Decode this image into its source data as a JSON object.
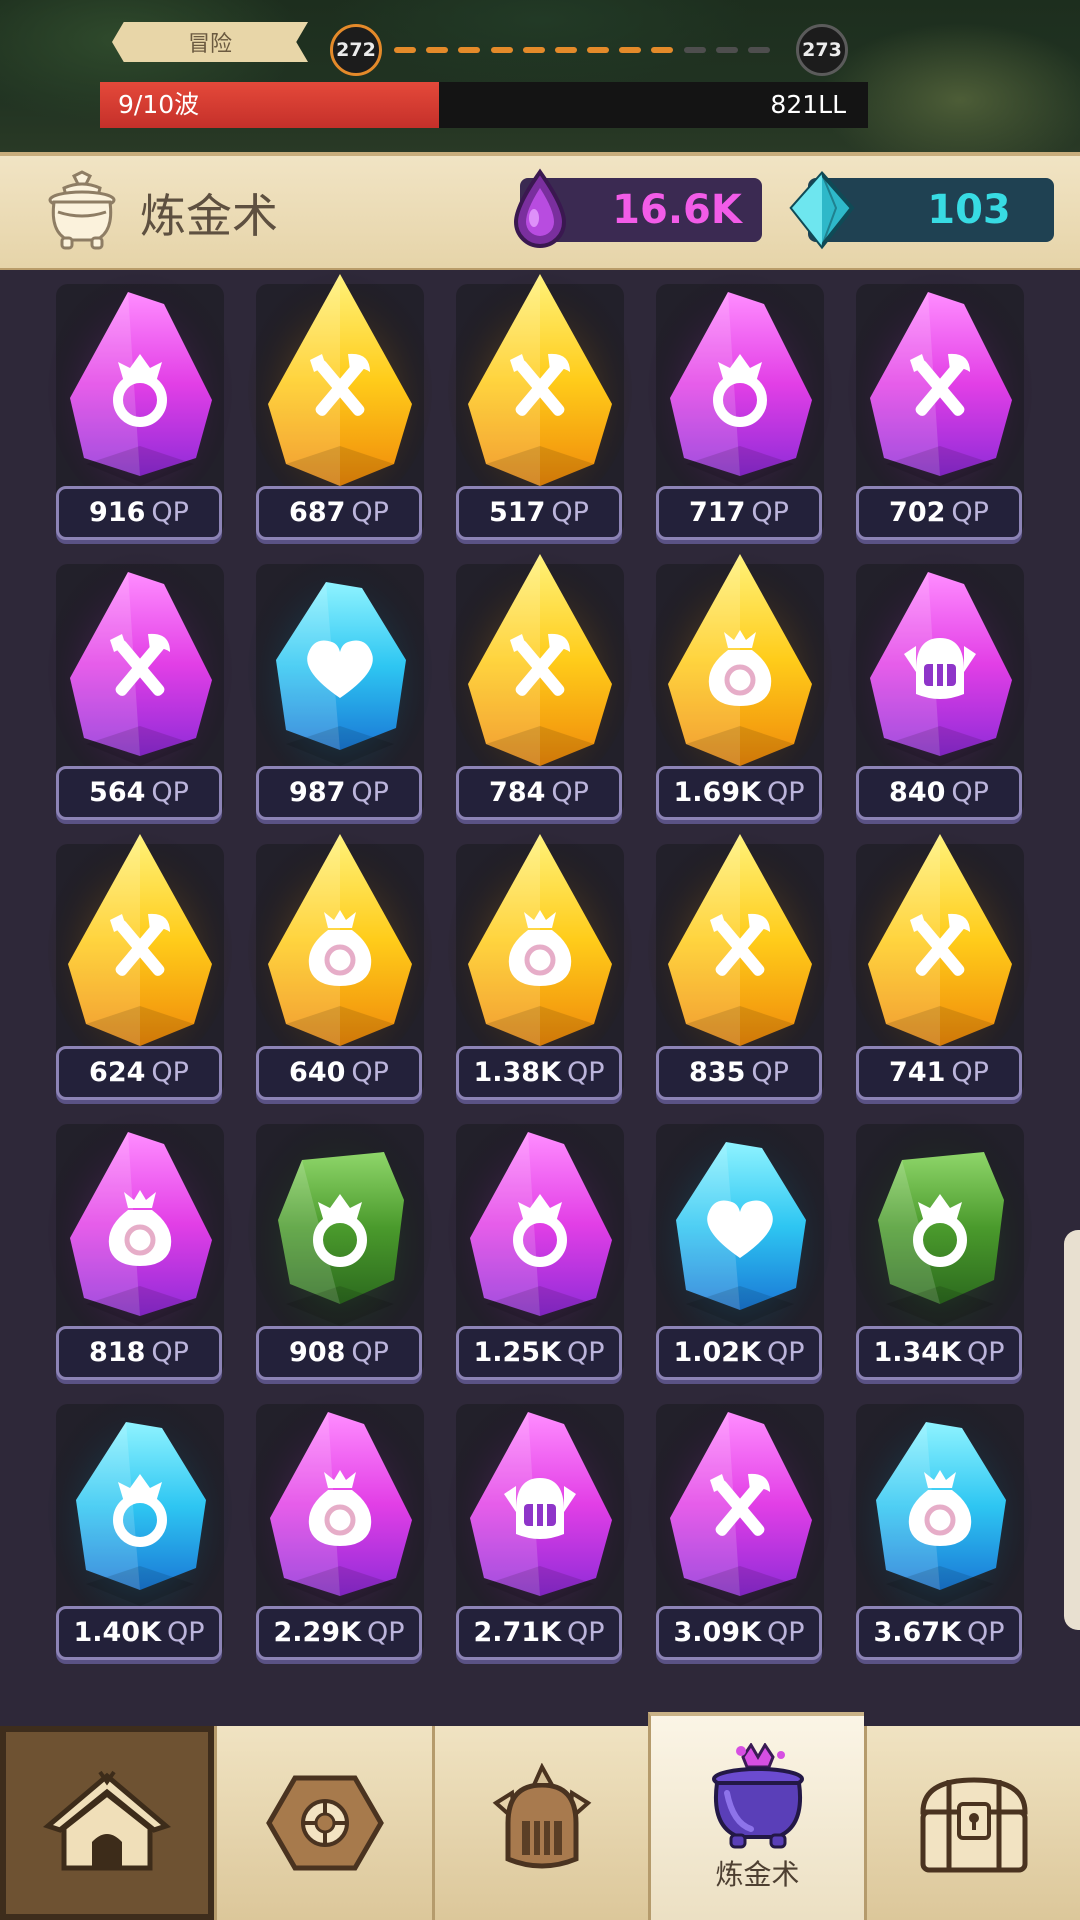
{
  "top_bar": {
    "mode_label": "冒险",
    "current_stage": "272",
    "next_stage": "273",
    "wave_text": "9/10波",
    "wave_progress": 0.9,
    "power_text": "821LL"
  },
  "header": {
    "title": "炼金术",
    "elixir_amount": "16.6K",
    "gem_amount": "103"
  },
  "crystals": [
    {
      "value": "916",
      "unit": "QP",
      "color": "purple",
      "icon": "ring-flame-icon"
    },
    {
      "value": "687",
      "unit": "QP",
      "color": "gold",
      "icon": "crossed-tools-icon"
    },
    {
      "value": "517",
      "unit": "QP",
      "color": "gold",
      "icon": "crossed-tools-icon"
    },
    {
      "value": "717",
      "unit": "QP",
      "color": "purple",
      "icon": "ring-flame-icon"
    },
    {
      "value": "702",
      "unit": "QP",
      "color": "purple",
      "icon": "crossed-tools-icon"
    },
    {
      "value": "564",
      "unit": "QP",
      "color": "purple",
      "icon": "crossed-tools-icon"
    },
    {
      "value": "987",
      "unit": "QP",
      "color": "cyan",
      "icon": "heart-icon"
    },
    {
      "value": "784",
      "unit": "QP",
      "color": "gold",
      "icon": "crossed-tools-icon"
    },
    {
      "value": "1.69K",
      "unit": "QP",
      "color": "gold",
      "icon": "money-bag-icon"
    },
    {
      "value": "840",
      "unit": "QP",
      "color": "purple",
      "icon": "knight-helmet-icon"
    },
    {
      "value": "624",
      "unit": "QP",
      "color": "gold",
      "icon": "crossed-tools-icon"
    },
    {
      "value": "640",
      "unit": "QP",
      "color": "gold",
      "icon": "money-bag-icon"
    },
    {
      "value": "1.38K",
      "unit": "QP",
      "color": "gold",
      "icon": "money-bag-icon"
    },
    {
      "value": "835",
      "unit": "QP",
      "color": "gold",
      "icon": "crossed-tools-icon"
    },
    {
      "value": "741",
      "unit": "QP",
      "color": "gold",
      "icon": "crossed-tools-icon"
    },
    {
      "value": "818",
      "unit": "QP",
      "color": "purple",
      "icon": "money-bag-icon"
    },
    {
      "value": "908",
      "unit": "QP",
      "color": "green",
      "icon": "ring-flame-icon"
    },
    {
      "value": "1.25K",
      "unit": "QP",
      "color": "purple",
      "icon": "ring-flame-icon"
    },
    {
      "value": "1.02K",
      "unit": "QP",
      "color": "cyan",
      "icon": "heart-icon"
    },
    {
      "value": "1.34K",
      "unit": "QP",
      "color": "green",
      "icon": "ring-flame-icon"
    },
    {
      "value": "1.40K",
      "unit": "QP",
      "color": "cyan",
      "icon": "ring-flame-icon"
    },
    {
      "value": "2.29K",
      "unit": "QP",
      "color": "purple",
      "icon": "money-bag-icon"
    },
    {
      "value": "2.71K",
      "unit": "QP",
      "color": "purple",
      "icon": "knight-helmet-icon"
    },
    {
      "value": "3.09K",
      "unit": "QP",
      "color": "purple",
      "icon": "crossed-tools-icon"
    },
    {
      "value": "3.67K",
      "unit": "QP",
      "color": "cyan",
      "icon": "money-bag-icon"
    }
  ],
  "colors": {
    "gold": [
      "#fff27a",
      "#ffcc1a",
      "#f08a0a"
    ],
    "purple": [
      "#ff8cff",
      "#e23fe6",
      "#8f2bd8"
    ],
    "cyan": [
      "#8ff3ff",
      "#2ec6f2",
      "#1a78d6"
    ],
    "green": [
      "#8fd66a",
      "#4a9a2c",
      "#2c6a1e"
    ],
    "accent_elixir": "#f25ce8",
    "accent_gem": "#38dbe3",
    "wave_bar": "#d93a30"
  },
  "nav": {
    "tabs": [
      {
        "name": "home",
        "icon": "camp-tent-icon",
        "label": ""
      },
      {
        "name": "relic",
        "icon": "hex-relic-icon",
        "label": ""
      },
      {
        "name": "hero",
        "icon": "knight-helmet-icon",
        "label": ""
      },
      {
        "name": "alchemy",
        "icon": "cauldron-icon",
        "label": "炼金术"
      },
      {
        "name": "chest",
        "icon": "treasure-chest-icon",
        "label": ""
      }
    ]
  }
}
